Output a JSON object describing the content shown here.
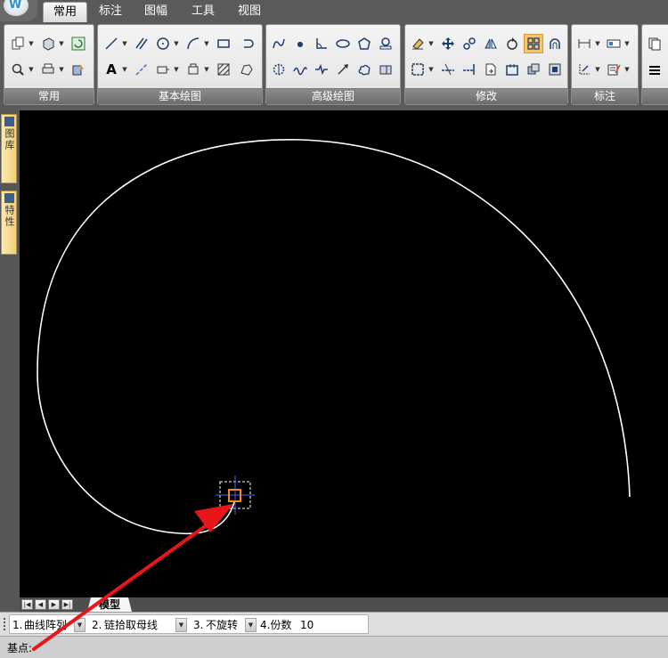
{
  "ribbon": {
    "tabs": [
      {
        "label": "常用",
        "active": true
      },
      {
        "label": "标注",
        "active": false
      },
      {
        "label": "图幅",
        "active": false
      },
      {
        "label": "工具",
        "active": false
      },
      {
        "label": "视图",
        "active": false
      }
    ],
    "panels": [
      "常用",
      "基本绘图",
      "高级绘图",
      "修改",
      "标注"
    ]
  },
  "dock": {
    "tabs": [
      {
        "label": "图库",
        "icon": "library-icon"
      },
      {
        "label": "特性",
        "icon": "properties-icon"
      }
    ]
  },
  "layout": {
    "model_tab": "模型"
  },
  "options": {
    "opt1_num": "1.",
    "opt1_value": "曲线阵列",
    "opt2_num": "2.",
    "opt2_value": "链拾取母线",
    "opt3_num": "3.",
    "opt3_value": "不旋转",
    "opt4_label": "4.份数",
    "opt4_value": "10"
  },
  "command": {
    "prompt": "基点:"
  },
  "colors": {
    "canvas": "#000000",
    "curve": "#ffffff",
    "arrow": "#e8161b",
    "pick_box": "#f28c1e"
  }
}
